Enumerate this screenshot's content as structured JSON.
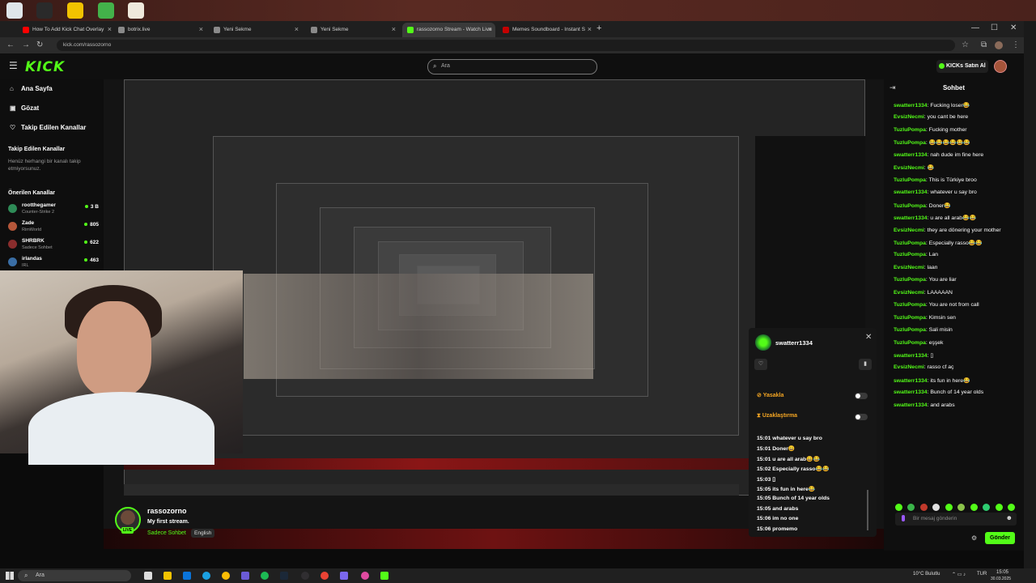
{
  "browser": {
    "tabs": [
      {
        "title": "How To Add Kick Chat Overlay",
        "active": false,
        "favicon_color": "#ff0000"
      },
      {
        "title": "botrix.live",
        "active": false,
        "favicon_color": "#8a8a8a"
      },
      {
        "title": "Yeni Sekme",
        "active": false,
        "favicon_color": "#8a8a8a"
      },
      {
        "title": "Yeni Sekme",
        "active": false,
        "favicon_color": "#8a8a8a"
      },
      {
        "title": "rassozorno Stream - Watch Live",
        "active": true,
        "favicon_color": "#53fc18"
      },
      {
        "title": "Memes Soundboard - Instant S",
        "active": false,
        "favicon_color": "#c40000"
      }
    ],
    "new_tab": "+",
    "url": "kick.com/rassozorno"
  },
  "kick": {
    "logo": "KICK",
    "search_placeholder": "Ara",
    "kicks_button": "KICKs Satın Al",
    "accent": "#53fc18"
  },
  "sidebar": {
    "nav": [
      {
        "label": "Ana Sayfa",
        "icon": "home-icon"
      },
      {
        "label": "Gözat",
        "icon": "browse-icon"
      },
      {
        "label": "Takip Edilen Kanallar",
        "icon": "heart-icon"
      }
    ],
    "followed_heading": "Takip Edilen Kanallar",
    "followed_empty": "Henüz herhangi bir kanalı takip etmiyorsunuz.",
    "recommended_heading": "Önerilen Kanallar",
    "recommended": [
      {
        "name": "rootthegamer",
        "category": "Counter-Strike 2",
        "viewers": "3 B",
        "color": "#2e8b57"
      },
      {
        "name": "Zade",
        "category": "RimWorld",
        "viewers": "805",
        "color": "#b5573a"
      },
      {
        "name": "SHRBRK",
        "category": "Sadece Sohbet",
        "viewers": "622",
        "color": "#8a2d2d"
      },
      {
        "name": "irlandas",
        "category": "IRL",
        "viewers": "463",
        "color": "#3a6ea5"
      }
    ]
  },
  "streamer": {
    "name": "rassozorno",
    "title": "My first stream.",
    "category": "Sadece Sohbet",
    "language": "English",
    "live_badge": "LIVE"
  },
  "user_popup": {
    "username": "swatterr1334",
    "ban_label": "Yasakla",
    "timeout_label": "Uzaklaştırma",
    "log": [
      "15:01 whatever u say bro",
      "15:01 Doner😄",
      "15:01 u are all arab😄😂",
      "15:02 Especially rasso😂😂",
      "15:03 ▯",
      "15:05 its fun in here😂",
      "15:05 Bunch of 14 year olds",
      "15:05 and arabs",
      "15:06 im no one",
      "15:06 promemo"
    ]
  },
  "chat": {
    "title": "Sohbet",
    "messages": [
      {
        "user": "swatterr1334",
        "text": "Fucking loser😂",
        "color": "#53fc18"
      },
      {
        "user": "EvsizNecmi",
        "text": "you cant be here",
        "color": "#53fc18"
      },
      {
        "user": "TuzluPompa",
        "text": "Fucking mother",
        "color": "#53fc18"
      },
      {
        "user": "TuzluPompa",
        "text": "😂😂😂😂😂😂",
        "color": "#53fc18"
      },
      {
        "user": "swatterr1334",
        "text": "nah dude im fine here",
        "color": "#53fc18"
      },
      {
        "user": "EvsizNecmi",
        "text": "😂",
        "color": "#53fc18"
      },
      {
        "user": "TuzluPompa",
        "text": "This is Türkiye broo",
        "color": "#53fc18"
      },
      {
        "user": "swatterr1334",
        "text": "whatever u say bro",
        "color": "#53fc18"
      },
      {
        "user": "TuzluPompa",
        "text": "Doner😂",
        "color": "#53fc18"
      },
      {
        "user": "swatterr1334",
        "text": "u are all arab😂😂",
        "color": "#53fc18"
      },
      {
        "user": "EvsizNecmi",
        "text": "they are dönering your mother",
        "color": "#53fc18"
      },
      {
        "user": "TuzluPompa",
        "text": "Especially rasso😂😂",
        "color": "#53fc18"
      },
      {
        "user": "TuzluPompa",
        "text": "Lan",
        "color": "#53fc18"
      },
      {
        "user": "EvsizNecmi",
        "text": "laan",
        "color": "#53fc18"
      },
      {
        "user": "TuzluPompa",
        "text": "You are liar",
        "color": "#53fc18"
      },
      {
        "user": "EvsizNecmi",
        "text": "LAAAAAN",
        "color": "#53fc18"
      },
      {
        "user": "TuzluPompa",
        "text": "You are not from call",
        "color": "#53fc18"
      },
      {
        "user": "TuzluPompa",
        "text": "Kimsin sen",
        "color": "#53fc18"
      },
      {
        "user": "TuzluPompa",
        "text": "Sali misin",
        "color": "#53fc18"
      },
      {
        "user": "TuzluPompa",
        "text": "eşşek",
        "color": "#53fc18"
      },
      {
        "user": "swatterr1334",
        "text": "▯",
        "color": "#53fc18"
      },
      {
        "user": "EvsizNecmi",
        "text": "rasso cf aç",
        "color": "#53fc18"
      },
      {
        "user": "swatterr1334",
        "text": "its fun in here😂",
        "color": "#53fc18"
      },
      {
        "user": "swatterr1334",
        "text": "Bunch of 14 year olds",
        "color": "#53fc18"
      },
      {
        "user": "swatterr1334",
        "text": "and arabs",
        "color": "#53fc18"
      }
    ],
    "input_placeholder": "Bir mesaj gönderin",
    "send_label": "Gönder"
  },
  "taskbar": {
    "search_placeholder": "Ara",
    "weather": "10°C Bulutlu",
    "lang": "TUR",
    "time": "15:05",
    "date": "30.03.2025"
  }
}
